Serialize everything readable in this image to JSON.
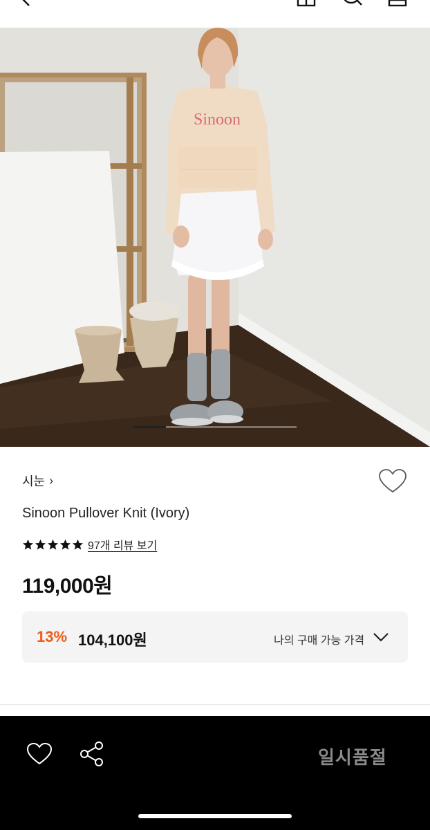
{
  "topbar": {
    "icons": [
      "back-icon",
      "home-icon",
      "search-icon",
      "bag-icon"
    ]
  },
  "product": {
    "brand": "시눈",
    "brand_chevron": "›",
    "name": "Sinoon Pullover Knit (Ivory)",
    "rating_stars": 5,
    "review_link": "97개 리뷰 보기",
    "price": "119,000원",
    "image_text": "Sinoon"
  },
  "discount": {
    "rate": "13%",
    "price": "104,100원",
    "label": "나의 구매 가능 가격"
  },
  "bottom_bar": {
    "status_button": "일시품절"
  },
  "colors": {
    "accent_discount": "#f05a1a",
    "bottom_bar_bg": "#000000",
    "discount_box_bg": "#f4f4f5"
  },
  "gallery": {
    "current_slide_fraction": 0.2
  }
}
